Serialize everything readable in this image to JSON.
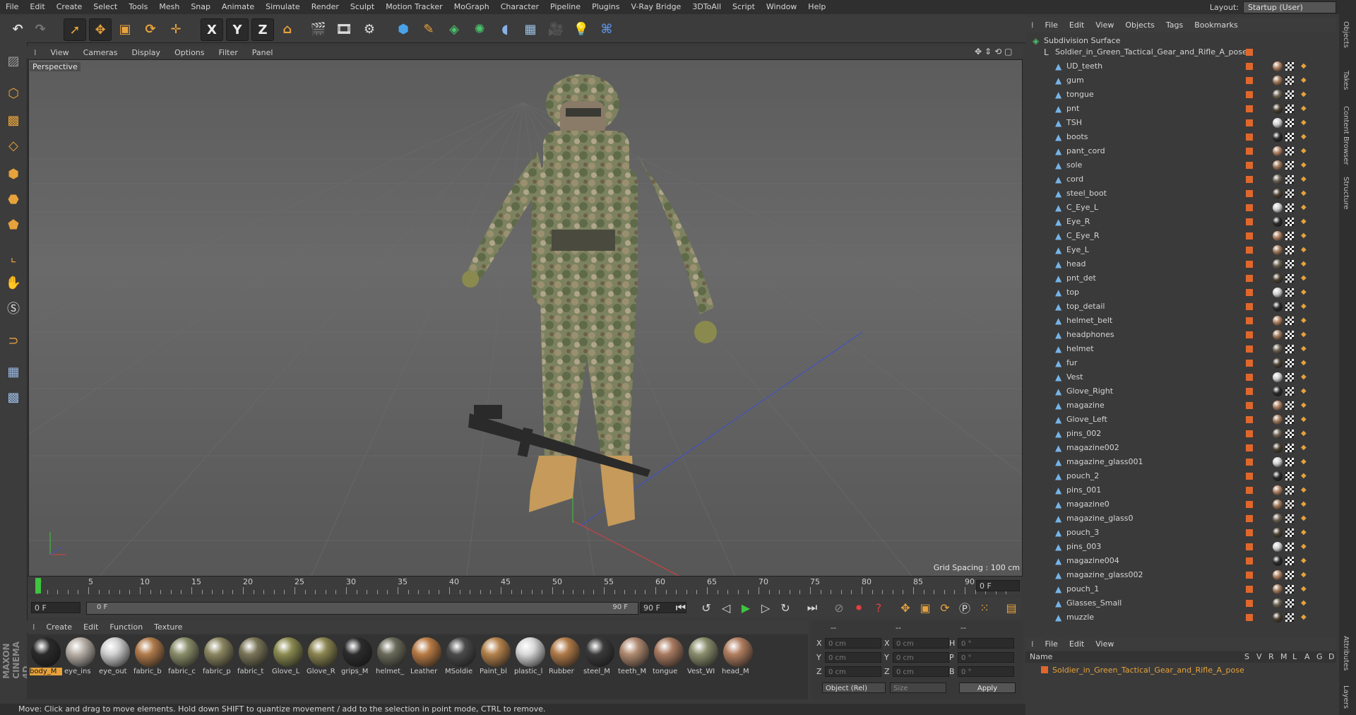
{
  "menubar": {
    "items": [
      "File",
      "Edit",
      "Create",
      "Select",
      "Tools",
      "Mesh",
      "Snap",
      "Animate",
      "Simulate",
      "Render",
      "Sculpt",
      "Motion Tracker",
      "MoGraph",
      "Character",
      "Pipeline",
      "Plugins",
      "V-Ray Bridge",
      "3DToAll",
      "Script",
      "Window",
      "Help"
    ],
    "layout_label": "Layout:",
    "layout_value": "Startup (User)"
  },
  "toolbar": {
    "axis_x": "X",
    "axis_y": "Y",
    "axis_z": "Z"
  },
  "viewport": {
    "menu": [
      "View",
      "Cameras",
      "Display",
      "Options",
      "Filter",
      "Panel"
    ],
    "label": "Perspective",
    "grid_spacing": "Grid Spacing : 100 cm"
  },
  "timeline": {
    "ticks": [
      "0",
      "5",
      "10",
      "15",
      "20",
      "25",
      "30",
      "35",
      "40",
      "45",
      "50",
      "55",
      "60",
      "65",
      "70",
      "75",
      "80",
      "85",
      "90"
    ],
    "current_frame_right": "0 F",
    "start_field": "0 F",
    "range_start": "0 F",
    "range_end": "90 F",
    "end_field": "90 F"
  },
  "materials": {
    "menu": [
      "Create",
      "Edit",
      "Function",
      "Texture"
    ],
    "items": [
      {
        "label": "body_M",
        "color": "#2a2a2a"
      },
      {
        "label": "eye_ins",
        "color": "#b8b0a8"
      },
      {
        "label": "eye_out",
        "color": "#d0d0d0"
      },
      {
        "label": "fabric_b",
        "color": "#b07a4a"
      },
      {
        "label": "fabric_c",
        "color": "#8a8e6a"
      },
      {
        "label": "fabric_p",
        "color": "#8a8560"
      },
      {
        "label": "fabric_t",
        "color": "#7a7558"
      },
      {
        "label": "Glove_L",
        "color": "#8a8a50"
      },
      {
        "label": "Glove_R",
        "color": "#8a8450"
      },
      {
        "label": "grips_M",
        "color": "#2c2c2c"
      },
      {
        "label": "helmet_",
        "color": "#6a6a5a"
      },
      {
        "label": "Leather",
        "color": "#b87a44"
      },
      {
        "label": "MSoldie",
        "color": "#4a4a4a"
      },
      {
        "label": "Paint_bl",
        "color": "#b4824c"
      },
      {
        "label": "plastic_l",
        "color": "#d8d8d8"
      },
      {
        "label": "Rubber",
        "color": "#b07a48"
      },
      {
        "label": "steel_M",
        "color": "#3a3a3a"
      },
      {
        "label": "teeth_M",
        "color": "#b08a70"
      },
      {
        "label": "tongue",
        "color": "#a87a60"
      },
      {
        "label": "Vest_WI",
        "color": "#8a8e6c"
      },
      {
        "label": "head_M",
        "color": "#b07e60"
      }
    ]
  },
  "coords": {
    "header1": "--",
    "header2": "--",
    "header3": "--",
    "rows": [
      {
        "a": "X",
        "av": "0 cm",
        "b": "X",
        "bv": "0 cm",
        "c": "H",
        "cv": "0 °"
      },
      {
        "a": "Y",
        "av": "0 cm",
        "b": "Y",
        "bv": "0 cm",
        "c": "P",
        "cv": "0 °"
      },
      {
        "a": "Z",
        "av": "0 cm",
        "b": "Z",
        "bv": "0 cm",
        "c": "B",
        "cv": "0 °"
      }
    ],
    "mode": "Object (Rel)",
    "size": "Size",
    "apply": "Apply"
  },
  "status": "Move: Click and drag to move elements. Hold down SHIFT to quantize movement / add to the selection in point mode, CTRL to remove.",
  "objects": {
    "menu": [
      "File",
      "Edit",
      "View",
      "Objects",
      "Tags",
      "Bookmarks"
    ],
    "root": "Subdivision Surface",
    "group": "Soldier_in_Green_Tactical_Gear_and_Rifle_A_pose",
    "items": [
      "UD_teeth",
      "gum",
      "tongue",
      "pnt",
      "TSH",
      "boots",
      "pant_cord",
      "sole",
      "cord",
      "steel_boot",
      "C_Eye_L",
      "Eye_R",
      "C_Eye_R",
      "Eye_L",
      "head",
      "pnt_det",
      "top",
      "top_detail",
      "helmet_belt",
      "headphones",
      "helmet",
      "fur",
      "Vest",
      "Glove_Right",
      "magazine",
      "Glove_Left",
      "pins_002",
      "magazine002",
      "magazine_glass001",
      "pouch_2",
      "pins_001",
      "magazine0",
      "magazine_glass0",
      "pouch_3",
      "pins_003",
      "magazine004",
      "magazine_glass002",
      "pouch_1",
      "Glasses_Small",
      "muzzle"
    ]
  },
  "attributes": {
    "menu": [
      "File",
      "Edit",
      "View"
    ],
    "name_header": "Name",
    "cols": [
      "S",
      "V",
      "R",
      "M",
      "L",
      "A",
      "G",
      "D"
    ],
    "row_name": "Soldier_in_Green_Tactical_Gear_and_Rifle_A_pose"
  },
  "right_tabs": [
    "Objects",
    "Takes",
    "Content Browser",
    "Structure",
    "Attributes",
    "Layers"
  ],
  "brand": "MAXON CINEMA 4D"
}
